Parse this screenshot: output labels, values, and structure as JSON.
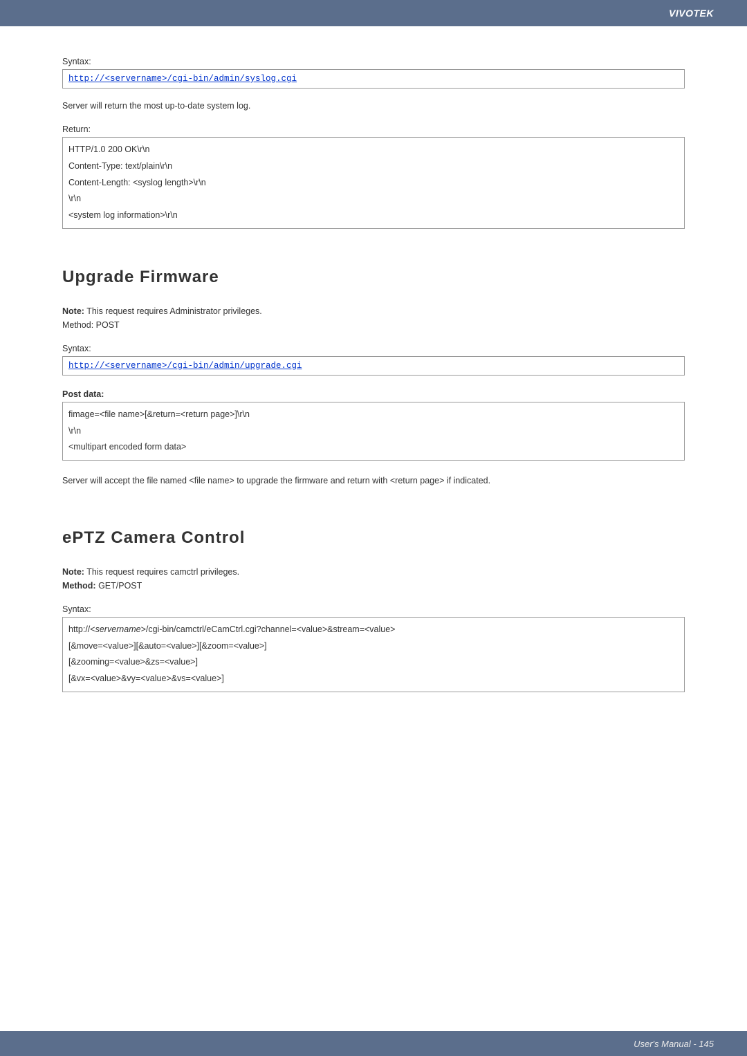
{
  "header": {
    "brand": "VIVOTEK"
  },
  "sect_syslog": {
    "syntax_label": "Syntax:",
    "url": "http://<servername>/cgi-bin/admin/syslog.cgi",
    "desc": "Server will return the most up-to-date system log.",
    "return_label": "Return:",
    "ret1": "HTTP/1.0 200 OK\\r\\n",
    "ret2": "Content-Type: text/plain\\r\\n",
    "ret3": "Content-Length: <syslog length>\\r\\n",
    "ret4": "\\r\\n",
    "ret5": "<system log information>\\r\\n"
  },
  "sect_upgrade": {
    "heading": "Upgrade Firmware",
    "note_label": "Note:",
    "note_text": " This request requires Administrator privileges.",
    "method": "Method: POST",
    "syntax_label": "Syntax:",
    "url": "http://<servername>/cgi-bin/admin/upgrade.cgi",
    "post_label": "Post data:",
    "post1": "fimage=<file name>[&return=<return page>]\\r\\n",
    "post2": "\\r\\n",
    "post3": "<multipart encoded form data>",
    "desc": "Server will accept the file named <file name> to upgrade the firmware and return with <return page> if indicated."
  },
  "sect_eptz": {
    "heading": "ePTZ Camera Control",
    "note_label": "Note:",
    "note_text": " This request requires camctrl privileges.",
    "method_label": "Method:",
    "method_val": " GET/POST",
    "syntax_label": "Syntax:",
    "s1a": "http://<",
    "s1b": "servername",
    "s1c": ">/cgi-bin/camctrl/eCamCtrl.cgi?channel=<value>&stream=<value>",
    "s2": "[&move=<value>][&auto=<value>][&zoom=<value>]",
    "s3": "[&zooming=<value>&zs=<value>]",
    "s4": "[&vx=<value>&vy=<value>&vs=<value>]"
  },
  "footer": {
    "text": "User's Manual - 145"
  }
}
